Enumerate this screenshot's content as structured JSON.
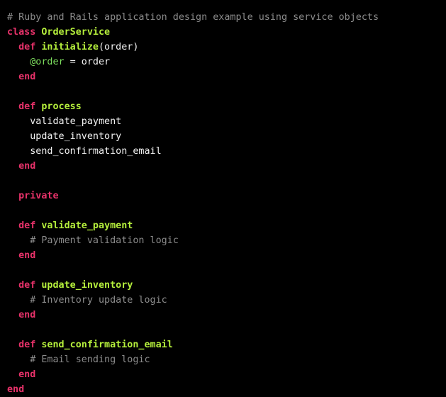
{
  "code_block": {
    "language": "ruby",
    "colors": {
      "background": "#000000",
      "comment": "#8c8c8c",
      "keyword": "#e8326a",
      "identifier": "#b6f03c",
      "instance_variable": "#7dde5e",
      "text": "#f2f2f2"
    },
    "lines": [
      [
        {
          "t": "comment",
          "v": "# Ruby and Rails application design example using service objects"
        }
      ],
      [
        {
          "t": "kw",
          "v": "class"
        },
        {
          "t": "text",
          "v": " "
        },
        {
          "t": "name",
          "v": "OrderService"
        }
      ],
      [
        {
          "t": "text",
          "v": "  "
        },
        {
          "t": "kw",
          "v": "def"
        },
        {
          "t": "text",
          "v": " "
        },
        {
          "t": "name",
          "v": "initialize"
        },
        {
          "t": "text",
          "v": "(order)"
        }
      ],
      [
        {
          "t": "text",
          "v": "    "
        },
        {
          "t": "ivar",
          "v": "@order"
        },
        {
          "t": "text",
          "v": " = order"
        }
      ],
      [
        {
          "t": "text",
          "v": "  "
        },
        {
          "t": "kw",
          "v": "end"
        }
      ],
      [],
      [
        {
          "t": "text",
          "v": "  "
        },
        {
          "t": "kw",
          "v": "def"
        },
        {
          "t": "text",
          "v": " "
        },
        {
          "t": "name",
          "v": "process"
        }
      ],
      [
        {
          "t": "text",
          "v": "    validate_payment"
        }
      ],
      [
        {
          "t": "text",
          "v": "    update_inventory"
        }
      ],
      [
        {
          "t": "text",
          "v": "    send_confirmation_email"
        }
      ],
      [
        {
          "t": "text",
          "v": "  "
        },
        {
          "t": "kw",
          "v": "end"
        }
      ],
      [],
      [
        {
          "t": "text",
          "v": "  "
        },
        {
          "t": "kw",
          "v": "private"
        }
      ],
      [],
      [
        {
          "t": "text",
          "v": "  "
        },
        {
          "t": "kw",
          "v": "def"
        },
        {
          "t": "text",
          "v": " "
        },
        {
          "t": "name",
          "v": "validate_payment"
        }
      ],
      [
        {
          "t": "text",
          "v": "    "
        },
        {
          "t": "comment",
          "v": "# Payment validation logic"
        }
      ],
      [
        {
          "t": "text",
          "v": "  "
        },
        {
          "t": "kw",
          "v": "end"
        }
      ],
      [],
      [
        {
          "t": "text",
          "v": "  "
        },
        {
          "t": "kw",
          "v": "def"
        },
        {
          "t": "text",
          "v": " "
        },
        {
          "t": "name",
          "v": "update_inventory"
        }
      ],
      [
        {
          "t": "text",
          "v": "    "
        },
        {
          "t": "comment",
          "v": "# Inventory update logic"
        }
      ],
      [
        {
          "t": "text",
          "v": "  "
        },
        {
          "t": "kw",
          "v": "end"
        }
      ],
      [],
      [
        {
          "t": "text",
          "v": "  "
        },
        {
          "t": "kw",
          "v": "def"
        },
        {
          "t": "text",
          "v": " "
        },
        {
          "t": "name",
          "v": "send_confirmation_email"
        }
      ],
      [
        {
          "t": "text",
          "v": "    "
        },
        {
          "t": "comment",
          "v": "# Email sending logic"
        }
      ],
      [
        {
          "t": "text",
          "v": "  "
        },
        {
          "t": "kw",
          "v": "end"
        }
      ],
      [
        {
          "t": "kw",
          "v": "end"
        }
      ]
    ]
  }
}
